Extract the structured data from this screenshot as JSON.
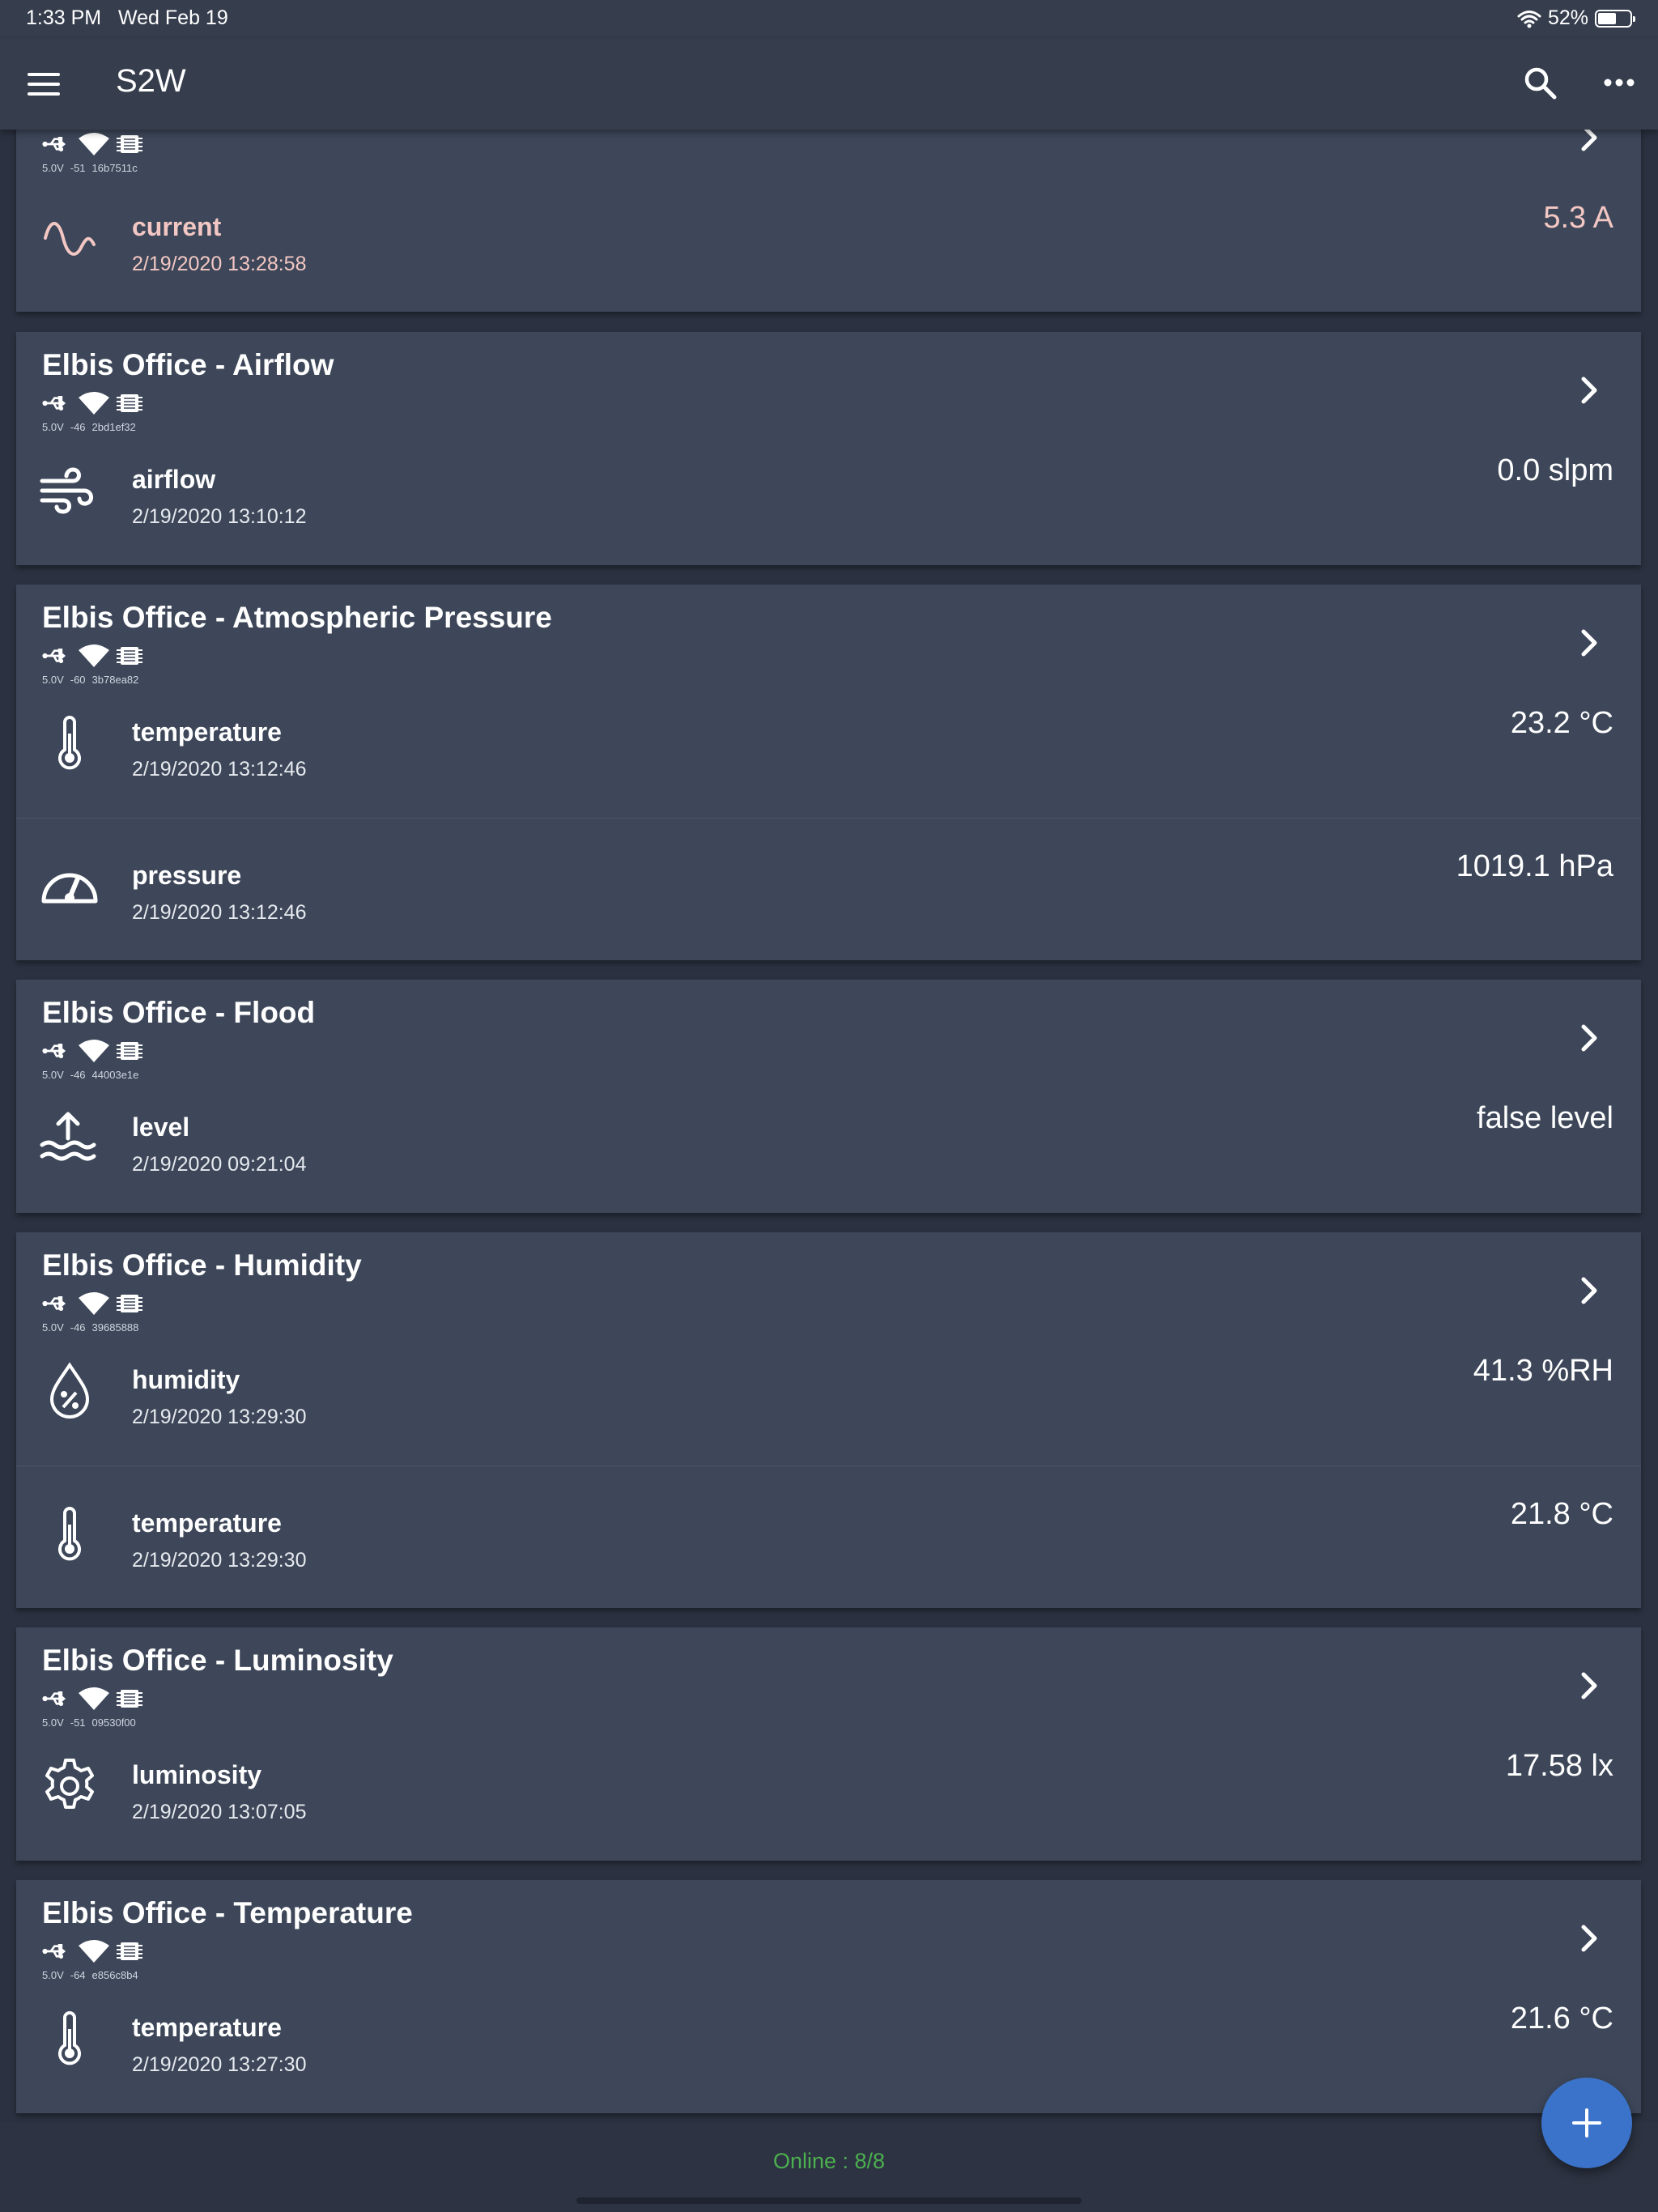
{
  "status_bar": {
    "time": "1:33 PM",
    "date": "Wed Feb 19",
    "battery": "52%"
  },
  "app": {
    "title": "S2W"
  },
  "cards": [
    {
      "name": "",
      "meta": {
        "voltage": "5.0V",
        "rssi": "-51",
        "id": "16b7511c"
      },
      "sensors": [
        {
          "label": "current",
          "time": "2/19/2020 13:28:58",
          "value": "5.3 A",
          "icon": "sine-wave-icon",
          "color": "#f3c7c3"
        }
      ]
    },
    {
      "name": "Elbis Office - Airflow",
      "meta": {
        "voltage": "5.0V",
        "rssi": "-46",
        "id": "2bd1ef32"
      },
      "sensors": [
        {
          "label": "airflow",
          "time": "2/19/2020 13:10:12",
          "value": "0.0 slpm",
          "icon": "wind-icon"
        }
      ]
    },
    {
      "name": "Elbis Office - Atmospheric Pressure",
      "meta": {
        "voltage": "5.0V",
        "rssi": "-60",
        "id": "3b78ea82"
      },
      "sensors": [
        {
          "label": "temperature",
          "time": "2/19/2020 13:12:46",
          "value": "23.2 °C",
          "icon": "thermometer-icon"
        },
        {
          "label": "pressure",
          "time": "2/19/2020 13:12:46",
          "value": "1019.1 hPa",
          "icon": "gauge-icon"
        }
      ]
    },
    {
      "name": "Elbis Office - Flood",
      "meta": {
        "voltage": "5.0V",
        "rssi": "-46",
        "id": "44003e1e"
      },
      "sensors": [
        {
          "label": "level",
          "time": "2/19/2020 09:21:04",
          "value": "false level",
          "icon": "flood-icon"
        }
      ]
    },
    {
      "name": "Elbis Office - Humidity",
      "meta": {
        "voltage": "5.0V",
        "rssi": "-46",
        "id": "39685888"
      },
      "sensors": [
        {
          "label": "humidity",
          "time": "2/19/2020 13:29:30",
          "value": "41.3 %RH",
          "icon": "water-percent-icon"
        },
        {
          "label": "temperature",
          "time": "2/19/2020 13:29:30",
          "value": "21.8 °C",
          "icon": "thermometer-icon"
        }
      ]
    },
    {
      "name": "Elbis Office - Luminosity",
      "meta": {
        "voltage": "5.0V",
        "rssi": "-51",
        "id": "09530f00"
      },
      "sensors": [
        {
          "label": "luminosity",
          "time": "2/19/2020 13:07:05",
          "value": "17.58 lx",
          "icon": "gear-icon"
        }
      ]
    },
    {
      "name": "Elbis Office - Temperature",
      "meta": {
        "voltage": "5.0V",
        "rssi": "-64",
        "id": "e856c8b4"
      },
      "sensors": [
        {
          "label": "temperature",
          "time": "2/19/2020 13:27:30",
          "value": "21.6 °C",
          "icon": "thermometer-icon"
        }
      ]
    }
  ],
  "footer": {
    "online": "Online : 8/8"
  }
}
